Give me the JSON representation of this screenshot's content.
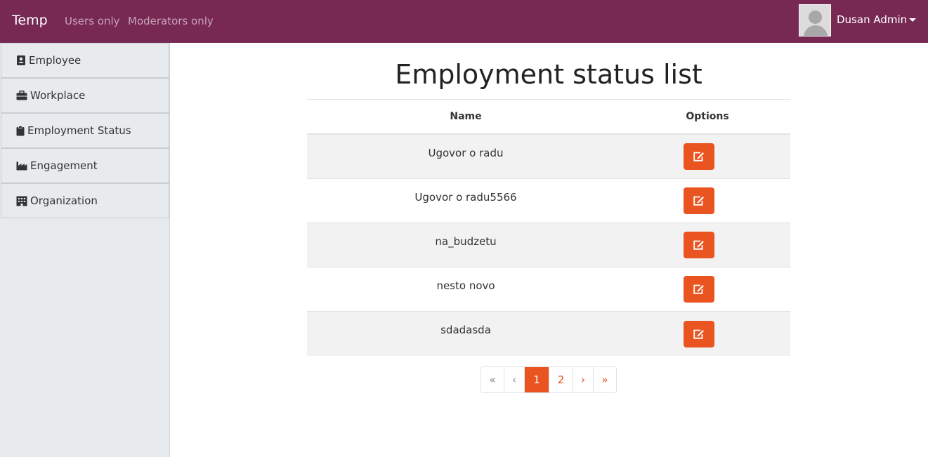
{
  "navbar": {
    "brand": "Temp",
    "links": [
      "Users only",
      "Moderators only"
    ],
    "user_name": "Dusan Admin",
    "bg_color": "#772953"
  },
  "sidebar": {
    "items": [
      {
        "label": "Employee",
        "icon": "address-card-icon"
      },
      {
        "label": "Workplace",
        "icon": "briefcase-icon"
      },
      {
        "label": "Employment Status",
        "icon": "clipboard-icon"
      },
      {
        "label": "Engagement",
        "icon": "industry-icon"
      },
      {
        "label": "Organization",
        "icon": "building-icon"
      }
    ]
  },
  "main": {
    "title": "Employment status list",
    "table": {
      "headers": [
        "Name",
        "Options"
      ],
      "rows": [
        "Ugovor o radu",
        "Ugovor o radu5566",
        "na_budzetu",
        "nesto novo",
        "sdadasda"
      ]
    },
    "pagination": {
      "first": "«",
      "prev": "‹",
      "pages": [
        "1",
        "2"
      ],
      "active_page": "1",
      "next": "›",
      "last": "»"
    }
  },
  "colors": {
    "accent": "#e95420",
    "navbar": "#772953"
  }
}
